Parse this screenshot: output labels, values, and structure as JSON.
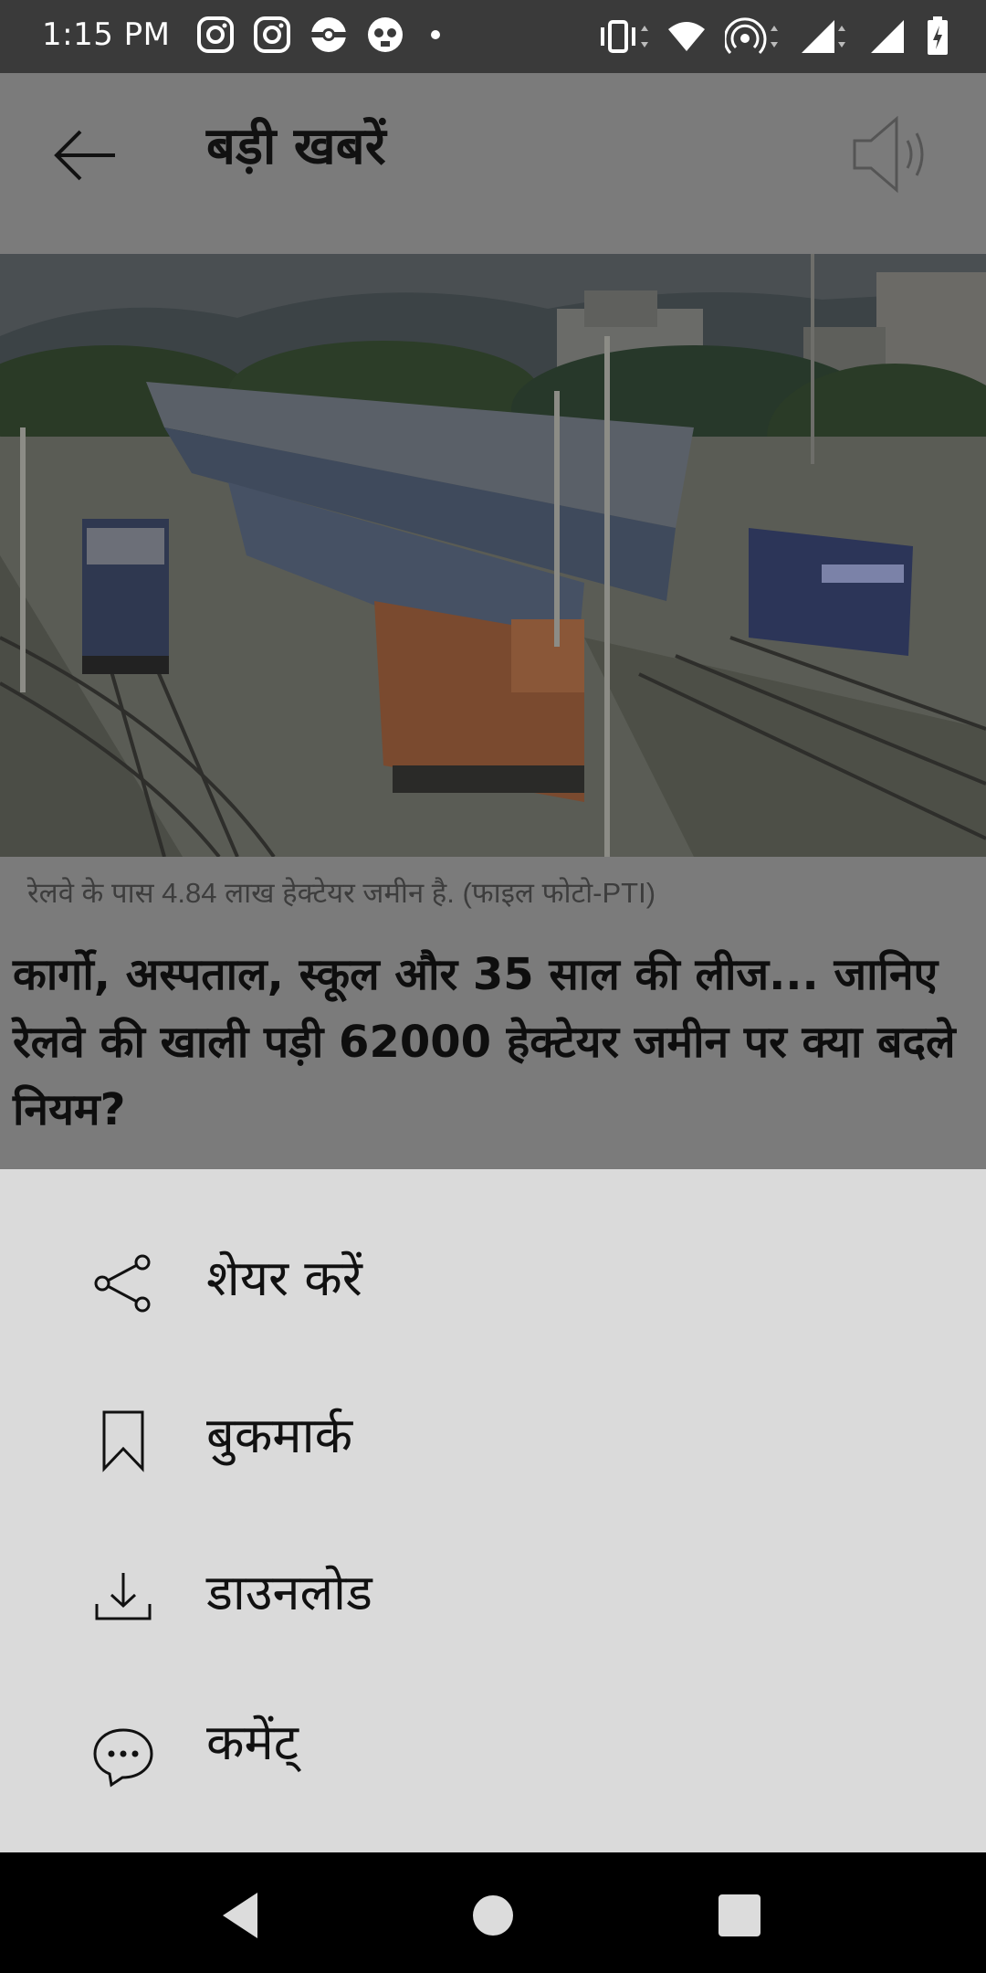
{
  "status_bar": {
    "time": "1:15 PM",
    "left_icons": [
      "instagram-icon",
      "instagram-icon",
      "pokeball-icon",
      "skull-icon",
      "dot-icon"
    ],
    "right_icons": [
      "vibrate-icon",
      "wifi-icon",
      "hotspot-icon",
      "signal-icon",
      "signal-icon",
      "battery-icon"
    ]
  },
  "header": {
    "title": "बड़ी खबरें",
    "back_icon": "arrow-left-icon",
    "speaker_icon": "speaker-icon"
  },
  "article": {
    "image_caption": "रेलवे के पास 4.84 लाख हेक्टेयर जमीन है. (फाइल फोटो-PTI)",
    "headline": "कार्गो, अस्पताल, स्कूल और 35 साल की लीज... जानिए रेलवे की खाली पड़ी 62000 हेक्टेयर जमीन पर क्या बदले नियम?"
  },
  "sheet": {
    "items": [
      {
        "label": "शेयर करें",
        "icon": "share-icon"
      },
      {
        "label": "बुकमार्क",
        "icon": "bookmark-icon"
      },
      {
        "label": "डाउनलोड",
        "icon": "download-icon"
      },
      {
        "label": "कमेंट्",
        "icon": "comment-icon"
      }
    ]
  },
  "nav": {
    "back": "nav-back-icon",
    "home": "nav-home-icon",
    "recents": "nav-recents-icon"
  },
  "colors": {
    "status_bar": "#3a3a3a",
    "header_dimmed": "#7b7b7b",
    "sheet_bg": "#dadada",
    "nav_bar": "#000000"
  }
}
